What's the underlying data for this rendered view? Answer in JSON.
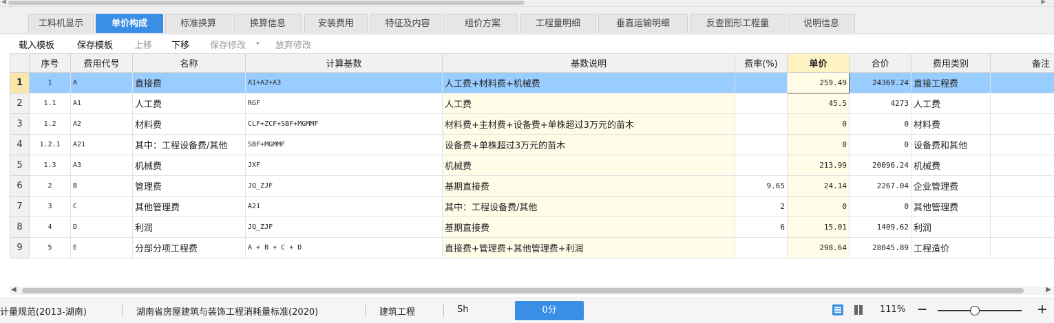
{
  "tabs": [
    {
      "label": "工料机显示"
    },
    {
      "label": "单价构成"
    },
    {
      "label": "标准换算"
    },
    {
      "label": "换算信息"
    },
    {
      "label": "安装费用"
    },
    {
      "label": "特征及内容"
    },
    {
      "label": "组价方案"
    },
    {
      "label": "工程量明细"
    },
    {
      "label": "垂直运输明细"
    },
    {
      "label": "反查图形工程量"
    },
    {
      "label": "说明信息"
    }
  ],
  "active_tab_index": 1,
  "toolbar": {
    "load_template": "载入模板",
    "save_template": "保存模板",
    "move_up": "上移",
    "move_down": "下移",
    "save_changes": "保存修改",
    "discard_changes": "放弃修改"
  },
  "columns": {
    "seq": "序号",
    "code": "费用代号",
    "name": "名称",
    "basis": "计算基数",
    "basis_desc": "基数说明",
    "rate": "费率(%)",
    "unit_price": "单价",
    "total_price": "合价",
    "category": "费用类别",
    "remark": "备注"
  },
  "rows": [
    {
      "rn": "1",
      "seq": "1",
      "code": "A",
      "name": "直接费",
      "basis": "A1+A2+A3",
      "basis_desc": "人工费+材料费+机械费",
      "rate": "",
      "unit_price": "259.49",
      "total_price": "24369.24",
      "category": "直接工程费",
      "remark": ""
    },
    {
      "rn": "2",
      "seq": "1.1",
      "code": "A1",
      "name": "人工费",
      "basis": "RGF",
      "basis_desc": "人工费",
      "rate": "",
      "unit_price": "45.5",
      "total_price": "4273",
      "category": "人工费",
      "remark": ""
    },
    {
      "rn": "3",
      "seq": "1.2",
      "code": "A2",
      "name": "材料费",
      "basis": "CLF+ZCF+SBF+MGMMF",
      "basis_desc": "材料费+主材费+设备费+单株超过3万元的苗木",
      "rate": "",
      "unit_price": "0",
      "total_price": "0",
      "category": "材料费",
      "remark": ""
    },
    {
      "rn": "4",
      "seq": "1.2.1",
      "code": "A21",
      "name": "其中：工程设备费/其他",
      "basis": "SBF+MGMMF",
      "basis_desc": "设备费+单株超过3万元的苗木",
      "rate": "",
      "unit_price": "0",
      "total_price": "0",
      "category": "设备费和其他",
      "remark": ""
    },
    {
      "rn": "5",
      "seq": "1.3",
      "code": "A3",
      "name": "机械费",
      "basis": "JXF",
      "basis_desc": "机械费",
      "rate": "",
      "unit_price": "213.99",
      "total_price": "20096.24",
      "category": "机械费",
      "remark": ""
    },
    {
      "rn": "6",
      "seq": "2",
      "code": "B",
      "name": "管理费",
      "basis": "JQ_ZJF",
      "basis_desc": "基期直接费",
      "rate": "9.65",
      "unit_price": "24.14",
      "total_price": "2267.04",
      "category": "企业管理费",
      "remark": ""
    },
    {
      "rn": "7",
      "seq": "3",
      "code": "C",
      "name": "其他管理费",
      "basis": "A21",
      "basis_desc": "其中：工程设备费/其他",
      "rate": "2",
      "unit_price": "0",
      "total_price": "0",
      "category": "其他管理费",
      "remark": ""
    },
    {
      "rn": "8",
      "seq": "4",
      "code": "D",
      "name": "利润",
      "basis": "JQ_ZJF",
      "basis_desc": "基期直接费",
      "rate": "6",
      "unit_price": "15.01",
      "total_price": "1409.62",
      "category": "利润",
      "remark": ""
    },
    {
      "rn": "9",
      "seq": "5",
      "code": "E",
      "name": "分部分项工程费",
      "basis": "A + B + C + D",
      "basis_desc": "直接费+管理费+其他管理费+利润",
      "rate": "",
      "unit_price": "298.64",
      "total_price": "28045.89",
      "category": "工程造价",
      "remark": ""
    }
  ],
  "selected_row_index": 0,
  "status_bar": {
    "spec": "计量规范(2013-湖南)",
    "standard": "湖南省房屋建筑与装饰工程消耗量标准(2020)",
    "discipline": "建筑工程",
    "sh": "Sh",
    "score": "0分",
    "zoom": "111%",
    "zoom_minus": "—",
    "zoom_plus": "+"
  },
  "colors": {
    "accent": "#3a8ee6",
    "selected_row": "#99ccff",
    "price_header": "#fff3c4",
    "light_yellow": "#fffce8"
  },
  "icons": {
    "grid_view": "grid-view-icon",
    "split_view": "split-view-icon"
  }
}
